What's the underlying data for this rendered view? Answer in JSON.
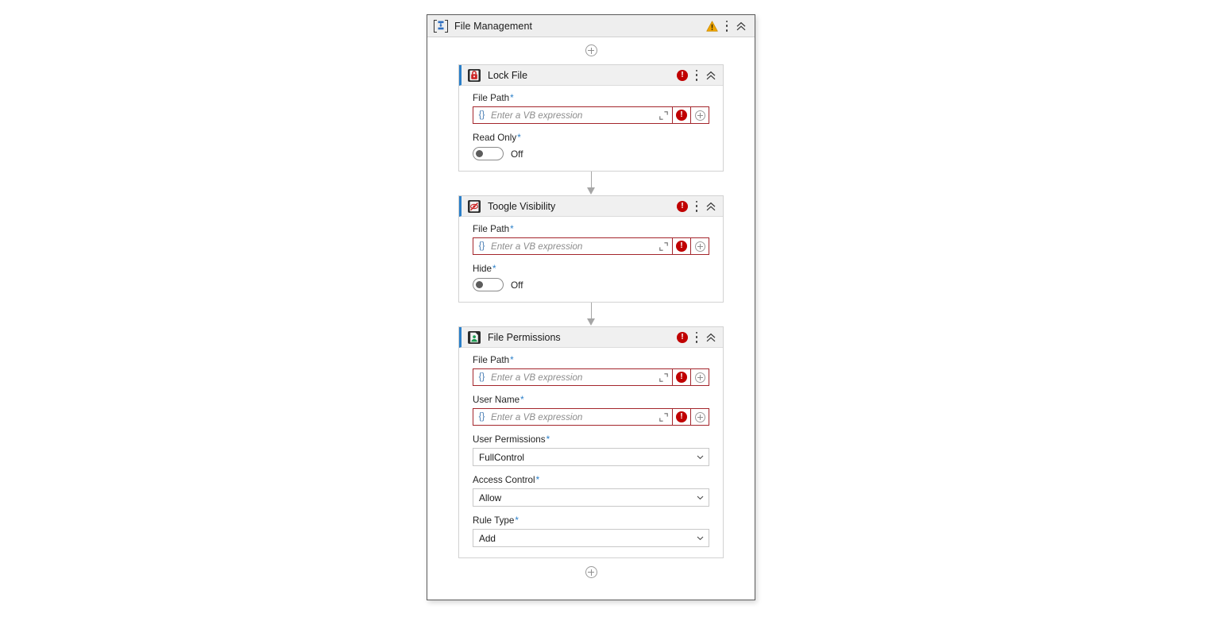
{
  "window": {
    "title": "File Management",
    "app_icon": "sequence-icon",
    "warning_icon": "warning-triangle-icon",
    "menu_icon": "kebab-menu-icon",
    "collapse_icon": "double-chevron-up-icon"
  },
  "colors": {
    "accent_blue": "#2a7fc9",
    "error_red": "#c00000",
    "error_border": "#a4262c",
    "warning_amber": "#f0a500",
    "header_bg": "#eeeeee",
    "card_header_bg": "#f0f0f0",
    "connector_gray": "#a6a6a6"
  },
  "flow": {
    "add_top_label": "+",
    "add_bottom_label": "+"
  },
  "common": {
    "expression_placeholder": "Enter a VB expression",
    "brace_glyph": "{}",
    "required_mark": "*",
    "toggle_off_label": "Off",
    "error_glyph": "!"
  },
  "activities": [
    {
      "title": "Lock File",
      "icon": "lock-file-icon",
      "status": "error",
      "fields": [
        {
          "type": "expression",
          "label": "File Path",
          "required": true,
          "value": "",
          "placeholder": "Enter a VB expression"
        },
        {
          "type": "toggle",
          "label": "Read Only",
          "required": true,
          "state": "Off"
        }
      ]
    },
    {
      "title": "Toogle Visibility",
      "icon": "toggle-visibility-icon",
      "status": "error",
      "fields": [
        {
          "type": "expression",
          "label": "File Path",
          "required": true,
          "value": "",
          "placeholder": "Enter a VB expression"
        },
        {
          "type": "toggle",
          "label": "Hide",
          "required": true,
          "state": "Off"
        }
      ]
    },
    {
      "title": "File Permissions",
      "icon": "file-permissions-icon",
      "status": "error",
      "fields": [
        {
          "type": "expression",
          "label": "File Path",
          "required": true,
          "value": "",
          "placeholder": "Enter a VB expression"
        },
        {
          "type": "expression",
          "label": "User Name",
          "required": true,
          "value": "",
          "placeholder": "Enter a VB expression"
        },
        {
          "type": "select",
          "label": "User Permissions",
          "required": true,
          "value": "FullControl"
        },
        {
          "type": "select",
          "label": "Access Control",
          "required": true,
          "value": "Allow"
        },
        {
          "type": "select",
          "label": "Rule Type",
          "required": true,
          "value": "Add"
        }
      ]
    }
  ]
}
